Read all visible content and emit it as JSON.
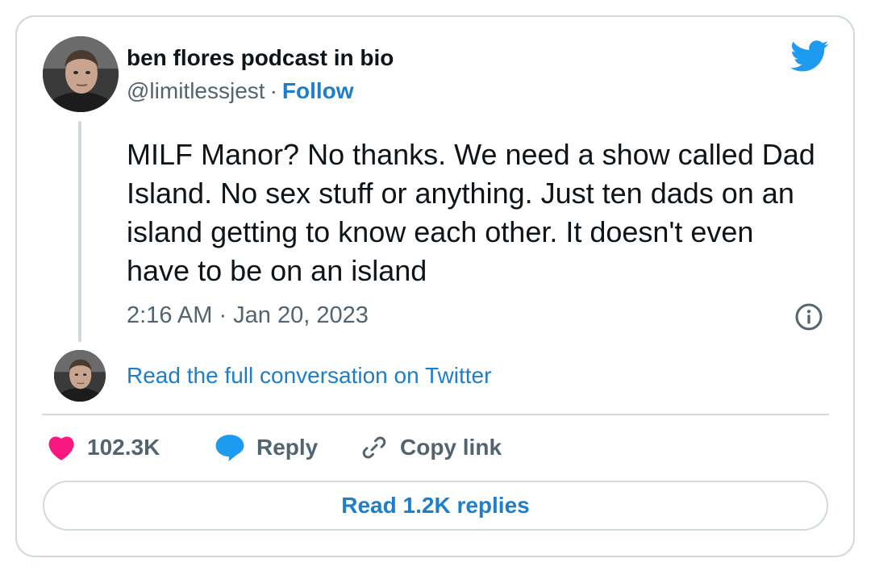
{
  "author": {
    "name": "ben flores podcast in bio",
    "handle": "@limitlessjest",
    "separator": "·",
    "follow_label": "Follow"
  },
  "tweet": {
    "text": "MILF Manor? No thanks. We need a show called Dad Island. No sex stuff or anything. Just ten dads on an island getting to know each other. It doesn't even have to be on an island",
    "timestamp": "2:16 AM · Jan 20, 2023"
  },
  "conversation": {
    "link_label": "Read the full conversation on Twitter"
  },
  "actions": {
    "likes_count": "102.3K",
    "reply_label": "Reply",
    "copy_link_label": "Copy link"
  },
  "replies_button": {
    "label": "Read 1.2K replies"
  },
  "icons": {
    "brand": "twitter-bird-icon",
    "like": "heart-icon",
    "reply": "speech-bubble-icon",
    "copy": "link-icon",
    "info": "info-icon"
  },
  "colors": {
    "accent": "#1d9bf0",
    "link": "#1d7ecb",
    "heart": "#f91880",
    "muted": "#536471",
    "border": "#cfd9de"
  }
}
